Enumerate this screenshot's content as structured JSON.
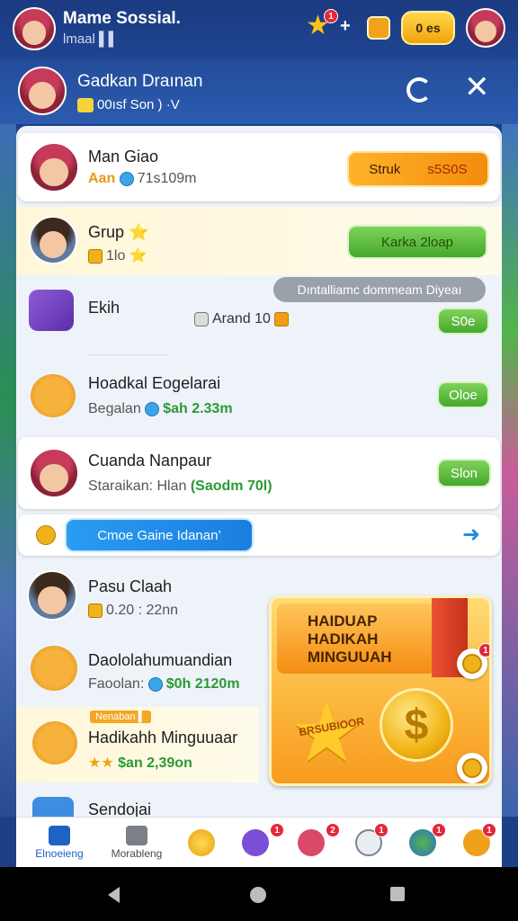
{
  "topbar": {
    "title": "Mame Sossial.",
    "subtitle": "lmaal ▌▌",
    "coins": "0 es",
    "star_badge": "1"
  },
  "group_header": {
    "title": "Gadkan Draınan",
    "subtitle": "00ısf Son ) ·V"
  },
  "rows": [
    {
      "name": "Man Giao",
      "sub_prefix": "Aan",
      "sub_value": "71s109m",
      "button": "Struk",
      "button_value": "s5S0S"
    },
    {
      "name": "Grup ⭐",
      "sub_value": "1lo ⭐",
      "button": "Karka 2loap"
    },
    {
      "name": "Ekih",
      "mid_text": "Arand 10",
      "tooltip": "Dıntalliamc dommeam Diyeaı",
      "button": "S0e"
    },
    {
      "name": "Hoadkal Eogelarai",
      "sub_prefix": "Begalan",
      "sub_value": "$ah 2.33m",
      "button": "Oloe"
    },
    {
      "name": "Cuanda Nanpaur",
      "sub_prefix": "Staraikan: Hlan",
      "sub_value": "(Saodm 70l)",
      "button": "Slon"
    },
    {
      "name": "Pasu Claah",
      "sub_value": "0.20 : 22nn"
    },
    {
      "name": "Daololahumuandian",
      "sub_prefix": "Faoolan:",
      "sub_value": "$0h 2120m"
    },
    {
      "name": "Hadikahh Minguuaar",
      "tag": "Nenaban ▌",
      "sub_value": "$an 2,39on"
    },
    {
      "name": "Sendojai"
    }
  ],
  "info_bar": {
    "text": "Cmoe Gaine Idanan’"
  },
  "reward": {
    "title_line1": "HAIDUAP",
    "title_line2": "HADIKAH",
    "title_line3": "MINGUUAH",
    "star_label": "BRSUBIOOR",
    "coin_symbol": "$",
    "badge": "1"
  },
  "bottom_nav": [
    {
      "label": "Elnoeieng",
      "icon": "home-icon"
    },
    {
      "label": "Morableng",
      "icon": "cards-icon"
    },
    {
      "label": "",
      "icon": "coin-icon"
    },
    {
      "label": "",
      "icon": "check-icon"
    },
    {
      "label": "",
      "icon": "ring-icon"
    },
    {
      "label": "",
      "icon": "tag-icon"
    },
    {
      "label": "",
      "icon": "globe-icon"
    },
    {
      "label": "",
      "icon": "rocket-icon"
    }
  ],
  "colors": {
    "header_bg": "#1b3a80",
    "accent_green": "#45a82c",
    "accent_orange": "#f38c0d",
    "accent_blue": "#1b7ee0"
  }
}
